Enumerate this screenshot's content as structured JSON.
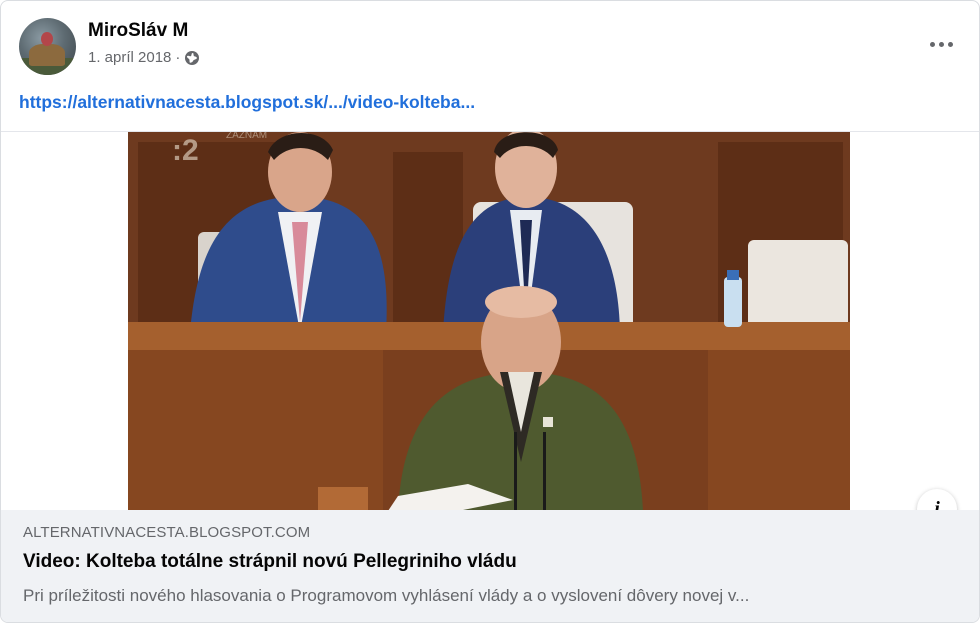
{
  "author": {
    "name": "MiroSláv M",
    "date": "1. apríl 2018",
    "separator": "·",
    "privacy_icon": "globe-icon"
  },
  "menu_icon": "more-options-icon",
  "post_link": "https://alternativnacesta.blogspot.sk/.../video-kolteba...",
  "media": {
    "overlay_icon": "info-icon",
    "overlay_label": "i",
    "watermark": "ZÁZNAM"
  },
  "link_preview": {
    "domain": "ALTERNATIVNACESTA.BLOGSPOT.COM",
    "title": "Video: Kolteba totálne strápnil novú Pellegriniho vládu",
    "description": "Pri príležitosti nového hlasovania o Programovom vyhlásení vlády a o vyslovení dôvery novej v..."
  },
  "colors": {
    "link": "#216fdb",
    "secondary_text": "#65676b",
    "preview_bg": "#f0f2f5"
  }
}
